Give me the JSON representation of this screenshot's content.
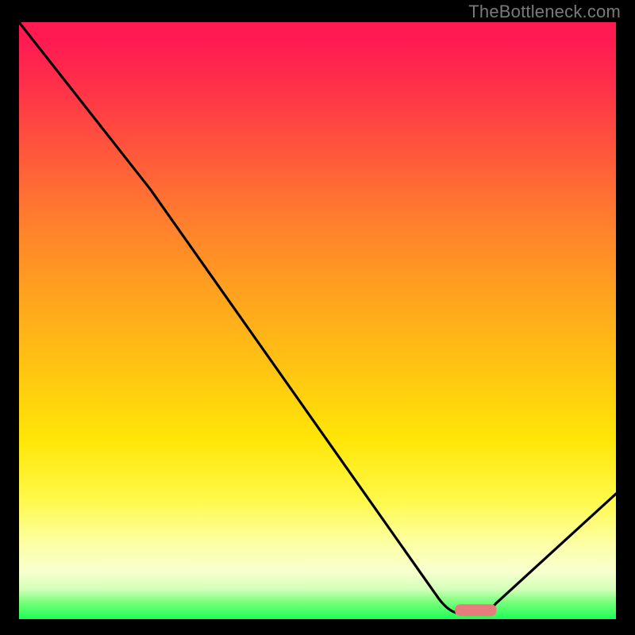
{
  "attribution": "TheBottleneck.com",
  "chart_data": {
    "type": "line",
    "title": "",
    "xlabel": "",
    "ylabel": "",
    "xlim": [
      0,
      100
    ],
    "ylim": [
      0,
      100
    ],
    "background_gradient": {
      "top_color": "#ff1a52",
      "mid_color": "#ffe607",
      "bottom_color": "#1bff54",
      "meaning": "red=high bottleneck, green=low bottleneck"
    },
    "series": [
      {
        "name": "bottleneck-curve",
        "color": "#000000",
        "x": [
          0,
          22,
          73,
          78,
          100
        ],
        "y": [
          100,
          72,
          1,
          1,
          21
        ]
      }
    ],
    "optimal_marker": {
      "x_range": [
        73,
        80
      ],
      "y": 1.5,
      "color": "#e77c7c",
      "shape": "rounded-bar"
    },
    "annotations": []
  }
}
